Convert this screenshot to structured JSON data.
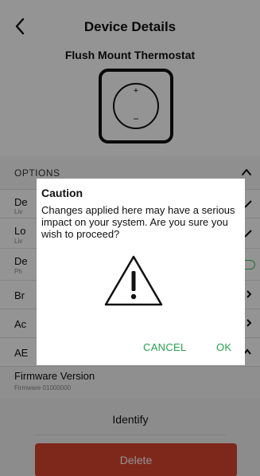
{
  "header": {
    "title": "Device Details",
    "device_name": "Flush Mount Thermostat",
    "thermostat_plus": "+",
    "thermostat_minus": "−"
  },
  "options": {
    "label": "OPTIONS",
    "rows": [
      {
        "title": "De",
        "sub": "Liv"
      },
      {
        "title": "Lo",
        "sub": "Liv"
      },
      {
        "title": "De",
        "sub": "Ph"
      },
      {
        "title": "Br",
        "sub": ""
      },
      {
        "title": "Ac",
        "sub": ""
      },
      {
        "title": "AE",
        "sub": ""
      }
    ]
  },
  "firmware": {
    "title": "Firmware Version",
    "value": "Firmware 01000000"
  },
  "actions": {
    "identify": "Identify",
    "delete": "Delete"
  },
  "dialog": {
    "title": "Caution",
    "message": "Changes applied here may have a serious impact on your system. Are you sure you wish to proceed?",
    "cancel": "CANCEL",
    "ok": "OK"
  },
  "colors": {
    "accent_green": "#2aa050",
    "delete_red": "#d9452f"
  }
}
